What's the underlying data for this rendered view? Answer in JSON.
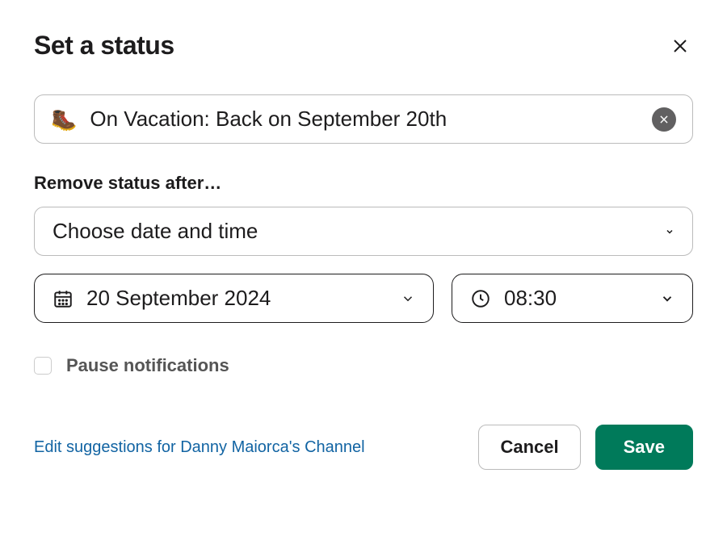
{
  "header": {
    "title": "Set a status"
  },
  "status": {
    "emoji": "🥾",
    "text": "On Vacation: Back on September 20th"
  },
  "remove_after": {
    "label": "Remove status after…",
    "dropdown_text": "Choose date and time",
    "date": "20 September 2024",
    "time": "08:30"
  },
  "pause": {
    "label": "Pause notifications",
    "checked": false
  },
  "footer": {
    "link_text": "Edit suggestions for Danny Maiorca's Channel",
    "cancel": "Cancel",
    "save": "Save"
  }
}
